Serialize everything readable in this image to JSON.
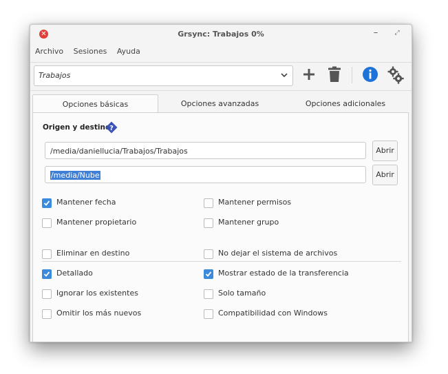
{
  "window": {
    "title": "Grsync: Trabajos 0%"
  },
  "menu": [
    "Archivo",
    "Sesiones",
    "Ayuda"
  ],
  "session": {
    "value": "Trabajos"
  },
  "toolbar": {
    "icons": [
      "plus-icon",
      "trash-icon",
      "info-icon",
      "gears-icon"
    ]
  },
  "tabs": [
    "Opciones básicas",
    "Opciones avanzadas",
    "Opciones adicionales"
  ],
  "panel": {
    "section_label": "Origen y destino:",
    "source_path": "/media/daniellucia/Trabajos/Trabajos",
    "destination_path": "/media/Nube",
    "open_label": "Abrir",
    "options_top": [
      {
        "label": "Mantener fecha",
        "checked": true
      },
      {
        "label": "Mantener permisos",
        "checked": false
      },
      {
        "label": "Mantener propietario",
        "checked": false
      },
      {
        "label": "Mantener grupo",
        "checked": false
      }
    ],
    "options_bottom": [
      {
        "label": "Eliminar en destino",
        "checked": false
      },
      {
        "label": "No dejar el sistema de archivos",
        "checked": false
      },
      {
        "label": "Detallado",
        "checked": true
      },
      {
        "label": "Mostrar estado de la transferencia",
        "checked": true
      },
      {
        "label": "Ignorar los existentes",
        "checked": false
      },
      {
        "label": "Solo tamaño",
        "checked": false
      },
      {
        "label": "Omitir los más nuevos",
        "checked": false
      },
      {
        "label": "Compatibilidad con Windows",
        "checked": false
      }
    ]
  },
  "colors": {
    "accent": "#3c8adb",
    "close": "#e0403a",
    "info": "#1e73d8"
  }
}
